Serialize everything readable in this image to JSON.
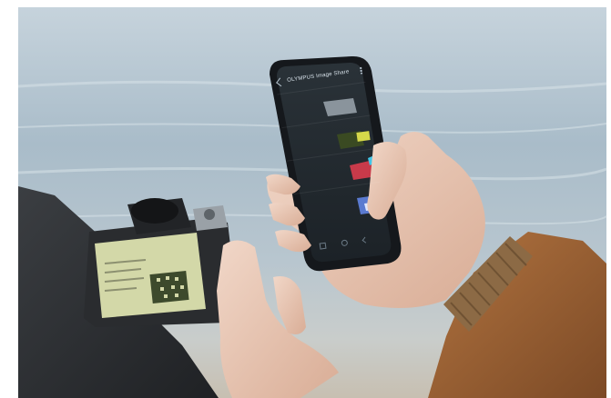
{
  "scene": {
    "description_tags": [
      "beach-background",
      "smartphone",
      "mirrorless-camera",
      "hands"
    ],
    "colors": {
      "sea_top": "#aebfcc",
      "sea_mid": "#8fa6b6",
      "sand": "#c8c2b6",
      "phone_body": "#1c1f24",
      "phone_screen": "#23292f",
      "jacket_left": "#2e3033",
      "jacket_right": "#9a5f31",
      "skin": "#e8c8b6",
      "camera_screen": "#d3d8a8",
      "accent_red": "#e2383f",
      "accent_cyan": "#41c6e8"
    }
  },
  "phone": {
    "status_time": "",
    "app_title": "OLYMPUS Image Share",
    "menu": [
      {
        "label": "",
        "sub": "",
        "icon": "remote-shot-icon"
      },
      {
        "label": "",
        "sub": "",
        "icon": "import-photos-icon"
      },
      {
        "label": "",
        "sub": "",
        "icon": "edit-photo-icon"
      },
      {
        "label": "",
        "sub": "",
        "icon": "art-filter-icon"
      }
    ]
  },
  "camera": {
    "screen_title": ""
  }
}
